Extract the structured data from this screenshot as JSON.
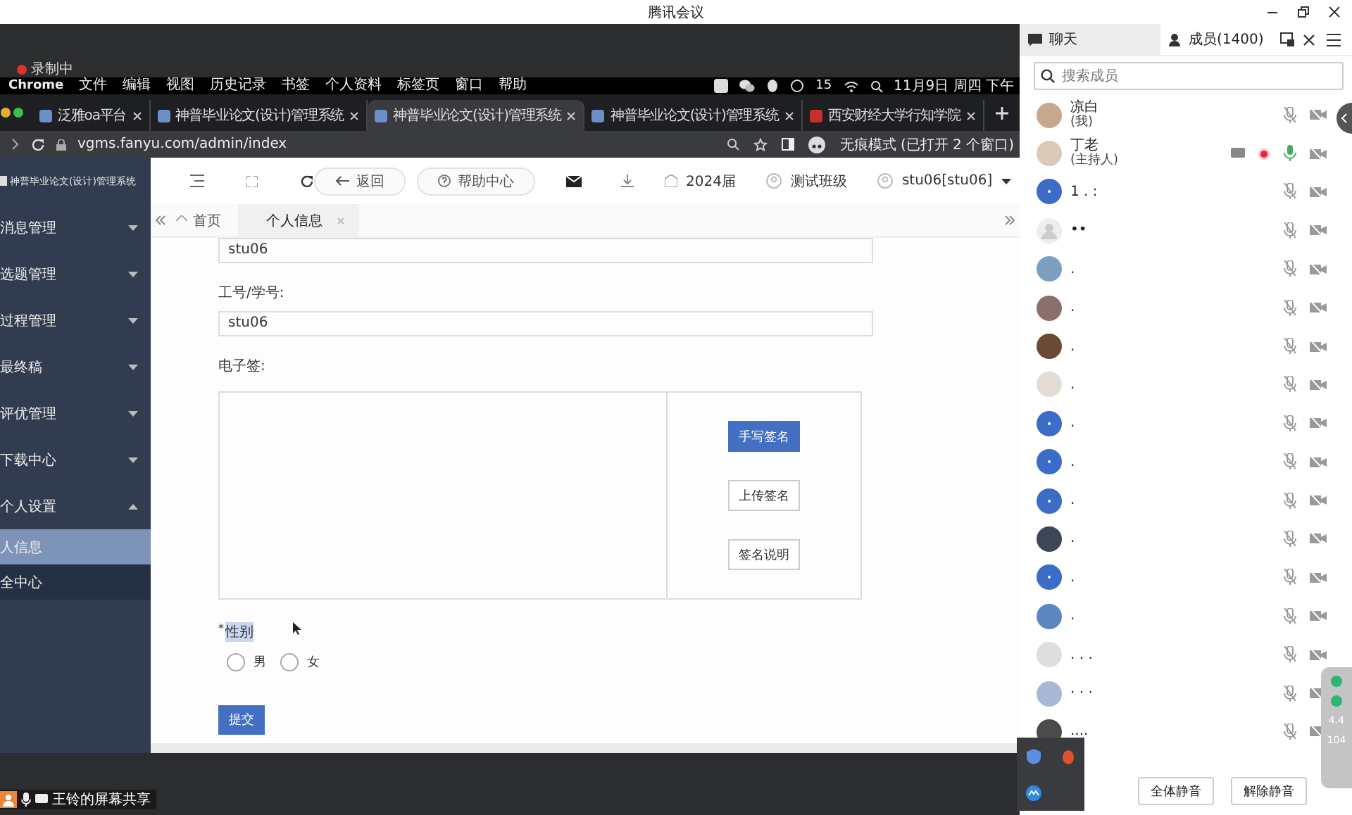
{
  "window": {
    "title": "腾讯会议"
  },
  "share": {
    "recording_label": "录制中",
    "sharer_label": "王铃的屏幕共享"
  },
  "menubar": {
    "app": "Chrome",
    "items": [
      "文件",
      "编辑",
      "视图",
      "历史记录",
      "书签",
      "个人资料",
      "标签页",
      "窗口",
      "帮助"
    ],
    "badge": "15",
    "clock": "11月9日 周四 下午"
  },
  "browser_tabs": [
    {
      "title": "泛雅oa平台",
      "selected": false
    },
    {
      "title": "神普毕业论文(设计)管理系统",
      "selected": false
    },
    {
      "title": "神普毕业论文(设计)管理系统",
      "selected": true
    },
    {
      "title": "神普毕业论文(设计)管理系统",
      "selected": false
    },
    {
      "title": "西安财经大学行知学院",
      "selected": false
    }
  ],
  "address_bar": {
    "url": "vgms.fanyu.com/admin/index",
    "incognito": "无痕模式 (已打开 2 个窗口)"
  },
  "app": {
    "system_title": "神普毕业论文(设计)管理系统",
    "sidebar": [
      {
        "label": "消息管理",
        "expanded": false
      },
      {
        "label": "选题管理",
        "expanded": false
      },
      {
        "label": "过程管理",
        "expanded": false
      },
      {
        "label": "最终稿",
        "expanded": false
      },
      {
        "label": "评优管理",
        "expanded": false
      },
      {
        "label": "下载中心",
        "expanded": false
      },
      {
        "label": "个人设置",
        "expanded": true,
        "children": [
          {
            "label": "人信息",
            "selected": true
          },
          {
            "label": "全中心",
            "selected": false
          }
        ]
      }
    ],
    "toolbar": {
      "back": "返回",
      "help": "帮助中心",
      "year": "2024届",
      "class_name": "测试班级",
      "user": "stu06[stu06]"
    },
    "page_tabs": [
      {
        "label": "首页",
        "selected": false
      },
      {
        "label": "个人信息",
        "selected": true
      }
    ],
    "form": {
      "fields": [
        {
          "value": "stu06"
        },
        {
          "label": "工号/学号:",
          "value": "stu06"
        }
      ],
      "signature_label": "电子签:",
      "signature_buttons": [
        {
          "label": "手写签名",
          "primary": true
        },
        {
          "label": "上传签名",
          "primary": false
        },
        {
          "label": "签名说明",
          "primary": false
        }
      ],
      "required_mark": "*",
      "gender_label": "性别",
      "gender_options": [
        {
          "label": "男",
          "selected": false
        },
        {
          "label": "女",
          "selected": false
        }
      ],
      "submit": "提交"
    }
  },
  "panel": {
    "tabs": [
      {
        "label": "聊天",
        "selected": false
      },
      {
        "label": "成员(1400)",
        "selected": true
      }
    ],
    "search_placeholder": "搜索成员",
    "members": [
      {
        "name": "凉白",
        "role": "(我)",
        "kind": "photo",
        "host": false
      },
      {
        "name": "丁老",
        "role": "(主持人)",
        "kind": "photo",
        "host": true
      },
      {
        "name": "1 . :",
        "kind": "blue",
        "host": false
      },
      {
        "name": "••",
        "kind": "grey",
        "host": false
      },
      {
        "name": ".",
        "kind": "photo",
        "host": false
      },
      {
        "name": ".",
        "kind": "photo",
        "host": false
      },
      {
        "name": ".",
        "kind": "photo",
        "host": false
      },
      {
        "name": ".",
        "kind": "photo",
        "host": false
      },
      {
        "name": ".",
        "kind": "blue",
        "host": false
      },
      {
        "name": ".",
        "kind": "blue",
        "host": false
      },
      {
        "name": ".",
        "kind": "blue",
        "host": false
      },
      {
        "name": ".",
        "kind": "photo",
        "host": false
      },
      {
        "name": ".",
        "kind": "blue",
        "host": false
      },
      {
        "name": ".",
        "kind": "photo",
        "host": false
      },
      {
        "name": ". . .",
        "kind": "photo",
        "host": false
      },
      {
        "name": "· · ·",
        "kind": "photo",
        "host": false
      },
      {
        "name": "....",
        "kind": "photo",
        "host": false
      }
    ],
    "buttons": [
      "全体静音",
      "解除静音"
    ],
    "network": {
      "up": "4.4",
      "down": "104"
    }
  }
}
